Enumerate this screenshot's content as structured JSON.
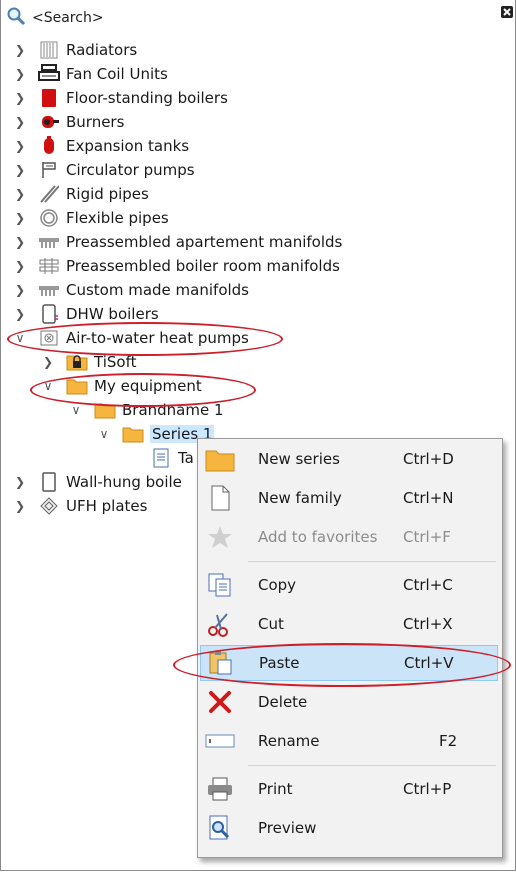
{
  "search": {
    "label": "<Search>"
  },
  "tree": {
    "items": [
      {
        "label": "Radiators",
        "icon": "radiator-icon"
      },
      {
        "label": "Fan Coil Units",
        "icon": "fan-coil-icon"
      },
      {
        "label": "Floor-standing boilers",
        "icon": "boiler-icon"
      },
      {
        "label": "Burners",
        "icon": "burner-icon"
      },
      {
        "label": "Expansion tanks",
        "icon": "expansion-tank-icon"
      },
      {
        "label": "Circulator pumps",
        "icon": "pump-icon"
      },
      {
        "label": "Rigid pipes",
        "icon": "rigid-pipe-icon"
      },
      {
        "label": "Flexible pipes",
        "icon": "flexible-pipe-icon"
      },
      {
        "label": "Preassembled apartement manifolds",
        "icon": "manifold-icon"
      },
      {
        "label": "Preassembled boiler room manifolds",
        "icon": "boiler-manifold-icon"
      },
      {
        "label": "Custom made manifolds",
        "icon": "custom-manifold-icon"
      },
      {
        "label": "DHW boilers",
        "icon": "dhw-boiler-icon"
      },
      {
        "label": "Air-to-water heat pumps",
        "icon": "heat-pump-icon"
      }
    ],
    "tisoft": "TiSoft",
    "my_equipment": "My equipment",
    "brandname": "Brandname 1",
    "series": "Series 1",
    "leaf": "Ta",
    "wall_hung": "Wall-hung boile",
    "ufh": "UFH plates"
  },
  "context_menu": {
    "items": [
      {
        "label": "New series",
        "shortcut": "Ctrl+D",
        "icon": "folder-icon"
      },
      {
        "label": "New family",
        "shortcut": "Ctrl+N",
        "icon": "document-icon"
      },
      {
        "label": "Add to favorites",
        "shortcut": "Ctrl+F",
        "icon": "star-icon",
        "disabled": true
      },
      {
        "label": "Copy",
        "shortcut": "Ctrl+C",
        "icon": "copy-icon"
      },
      {
        "label": "Cut",
        "shortcut": "Ctrl+X",
        "icon": "scissors-icon"
      },
      {
        "label": "Paste",
        "shortcut": "Ctrl+V",
        "icon": "paste-icon",
        "highlighted": true
      },
      {
        "label": "Delete",
        "shortcut": "",
        "icon": "delete-icon"
      },
      {
        "label": "Rename",
        "shortcut": "F2",
        "icon": "rename-icon"
      },
      {
        "label": "Print",
        "shortcut": "Ctrl+P",
        "icon": "printer-icon"
      },
      {
        "label": "Preview",
        "shortcut": "",
        "icon": "preview-icon"
      }
    ]
  },
  "colors": {
    "annotation": "#cc1f2b",
    "highlight": "#cce4f7",
    "folder": "#f5b53f",
    "boiler_red": "#d01010"
  }
}
